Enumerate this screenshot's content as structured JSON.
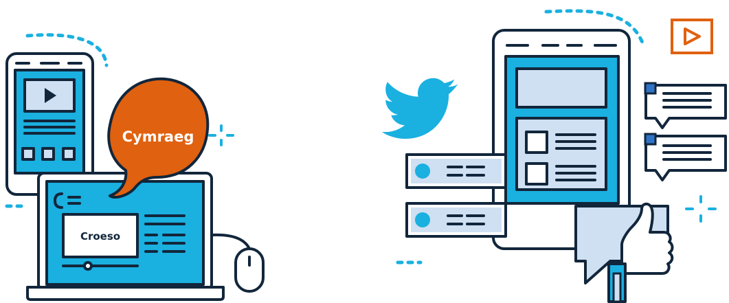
{
  "left_illustration": {
    "speech_bubble_text": "Cymraeg",
    "screen_card_text": "Croeso",
    "laptop_logo_glyph": "C="
  },
  "right_illustration": {
    "icons": [
      "twitter-bird-icon",
      "play-button-icon",
      "thumbs-up-icon",
      "chat-bubble-icon"
    ]
  },
  "colors": {
    "cyan": "#1ab0e0",
    "light_blue": "#cfe0f2",
    "navy": "#12263b",
    "orange": "#e0610f",
    "white": "#ffffff"
  }
}
